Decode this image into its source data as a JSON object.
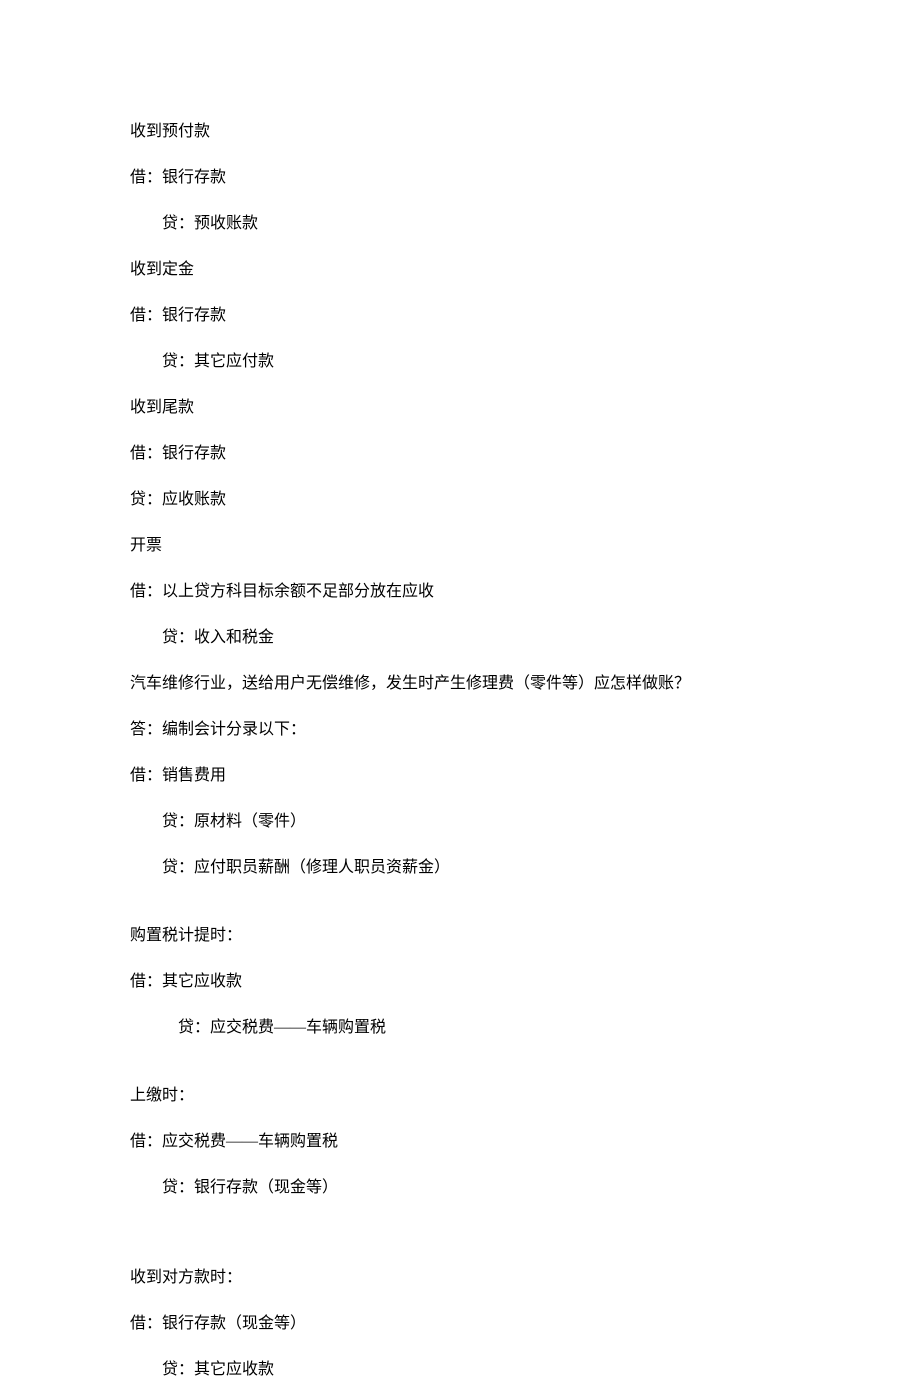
{
  "lines": [
    {
      "text": "收到预付款",
      "class": "line"
    },
    {
      "text": "借：银行存款",
      "class": "line"
    },
    {
      "text": "贷：预收账款",
      "class": "line indent-1"
    },
    {
      "text": "收到定金",
      "class": "line"
    },
    {
      "text": "借：银行存款",
      "class": "line"
    },
    {
      "text": "贷：其它应付款",
      "class": "line indent-1"
    },
    {
      "text": "收到尾款",
      "class": "line"
    },
    {
      "text": "借：银行存款",
      "class": "line"
    },
    {
      "text": "贷：应收账款",
      "class": "line"
    },
    {
      "text": "开票",
      "class": "line"
    },
    {
      "text": "借：以上贷方科目标余额不足部分放在应收",
      "class": "line"
    },
    {
      "text": "贷：收入和税金",
      "class": "line indent-1"
    },
    {
      "text": " 汽车维修行业，送给用户无偿维修，发生时产生修理费（零件等）应怎样做账？",
      "class": "line"
    },
    {
      "text": "答：编制会计分录以下：",
      "class": "line"
    },
    {
      "text": "借：销售费用",
      "class": "line"
    },
    {
      "text": "贷：原材料（零件）",
      "class": "line indent-1"
    },
    {
      "text": "贷：应付职员薪酬（修理人职员资薪金）",
      "class": "line indent-1"
    },
    {
      "text": "",
      "class": "gap"
    },
    {
      "text": "购置税计提时：",
      "class": "line"
    },
    {
      "text": "借：其它应收款",
      "class": "line"
    },
    {
      "text": "贷：应交税费——车辆购置税",
      "class": "line indent-2"
    },
    {
      "text": "",
      "class": "gap"
    },
    {
      "text": "上缴时：",
      "class": "line"
    },
    {
      "text": "借：应交税费——车辆购置税",
      "class": "line"
    },
    {
      "text": "贷：银行存款（现金等）",
      "class": "line indent-1"
    },
    {
      "text": "",
      "class": "gap"
    },
    {
      "text": "",
      "class": "gap"
    },
    {
      "text": "收到对方款时：",
      "class": "line"
    },
    {
      "text": "借：银行存款（现金等）",
      "class": "line"
    },
    {
      "text": "贷：其它应收款",
      "class": "line indent-1"
    }
  ]
}
